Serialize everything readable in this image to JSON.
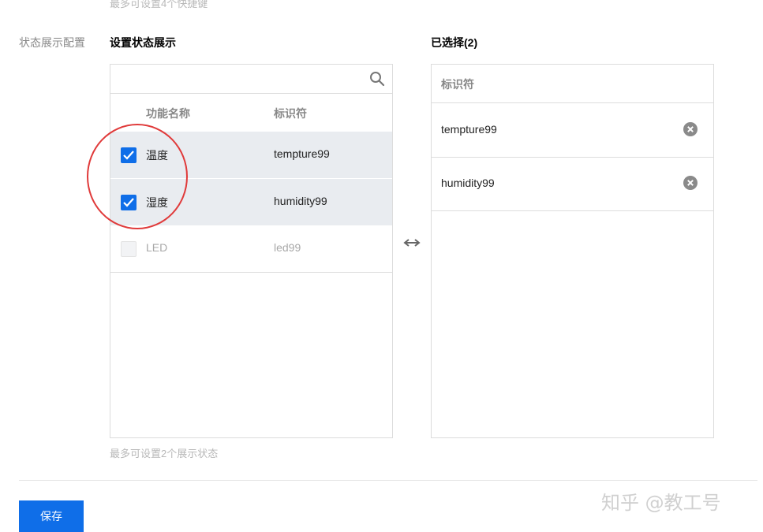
{
  "top_hint": "最多可设置4个快捷键",
  "field_label": "状态展示配置",
  "left_panel": {
    "title": "设置状态展示",
    "search_placeholder": "",
    "columns": [
      "功能名称",
      "标识符"
    ],
    "rows": [
      {
        "name": "温度",
        "id": "tempture99",
        "checked": true,
        "disabled": false
      },
      {
        "name": "湿度",
        "id": "humidity99",
        "checked": true,
        "disabled": false
      },
      {
        "name": "LED",
        "id": "led99",
        "checked": false,
        "disabled": true
      }
    ]
  },
  "right_panel": {
    "title": "已选择(2)",
    "column": "标识符",
    "items": [
      {
        "id": "tempture99"
      },
      {
        "id": "humidity99"
      }
    ]
  },
  "bottom_hint": "最多可设置2个展示状态",
  "save_label": "保存",
  "watermark": "知乎 @教工号",
  "colors": {
    "primary": "#0f6ee8",
    "selected_row": "#e9ecf0",
    "annotation": "#e03a3a"
  }
}
